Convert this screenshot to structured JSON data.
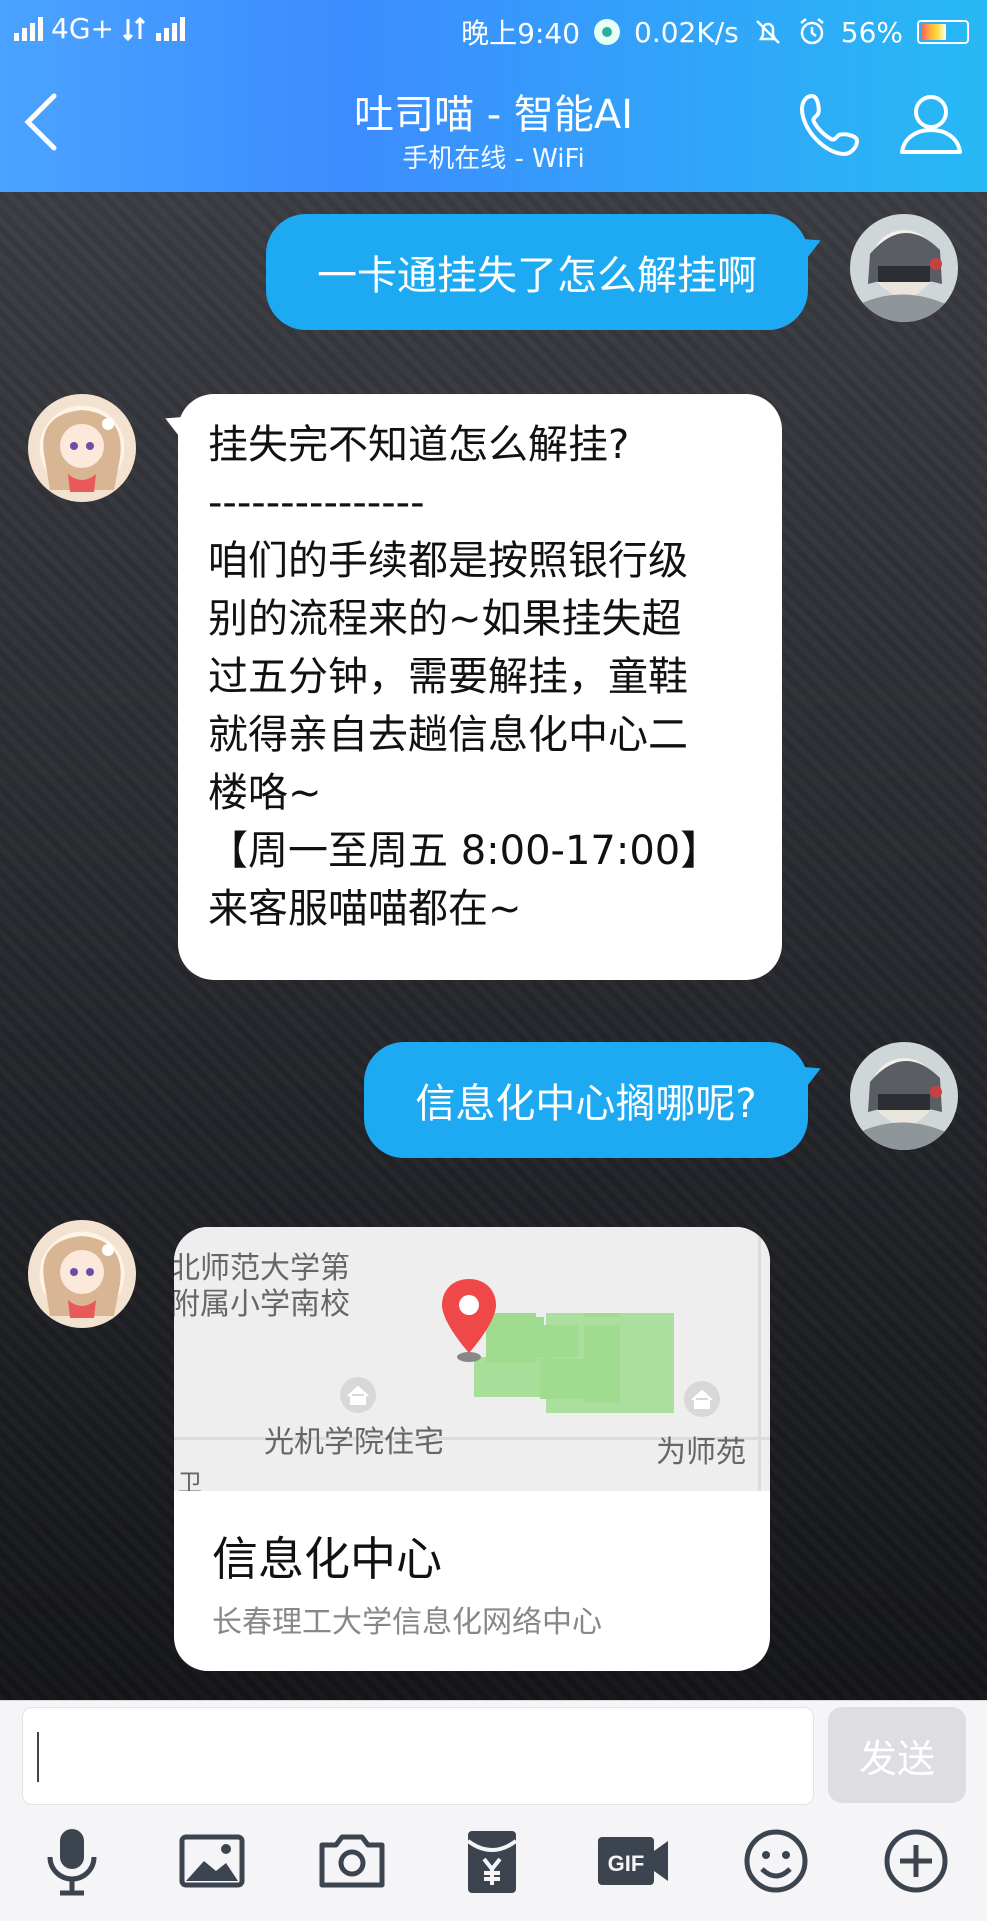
{
  "status": {
    "network1": "4G+",
    "time": "晚上9:40",
    "speed": "0.02K/s",
    "battery": "56%",
    "battery_level": 0.56
  },
  "header": {
    "title": "吐司喵 - 智能AI",
    "subtitle": "手机在线 - WiFi"
  },
  "messages": [
    {
      "from": "me",
      "text": "一卡通挂失了怎么解挂啊"
    },
    {
      "from": "bot",
      "lines": [
        "挂失完不知道怎么解挂?",
        "---------------",
        "咱们的手续都是按照银行级",
        "别的流程来的~如果挂失超",
        "过五分钟，需要解挂，童鞋",
        "就得亲自去趟信息化中心二",
        "楼咯~",
        "【周一至周五 8:00-17:00】",
        "来客服喵喵都在~"
      ]
    },
    {
      "from": "me",
      "text": "信息化中心搁哪呢?"
    }
  ],
  "location_card": {
    "map_labels": [
      "北师范大学第",
      "附属小学南校",
      "光机学院住宅",
      "为师苑",
      "卫"
    ],
    "title": "信息化中心",
    "address": "长春理工大学信息化网络中心"
  },
  "input": {
    "value": "",
    "send_label": "发送"
  },
  "toolbar": [
    "microphone-icon",
    "image-icon",
    "camera-icon",
    "red-packet-icon",
    "gif-icon",
    "emoji-icon",
    "plus-icon"
  ]
}
